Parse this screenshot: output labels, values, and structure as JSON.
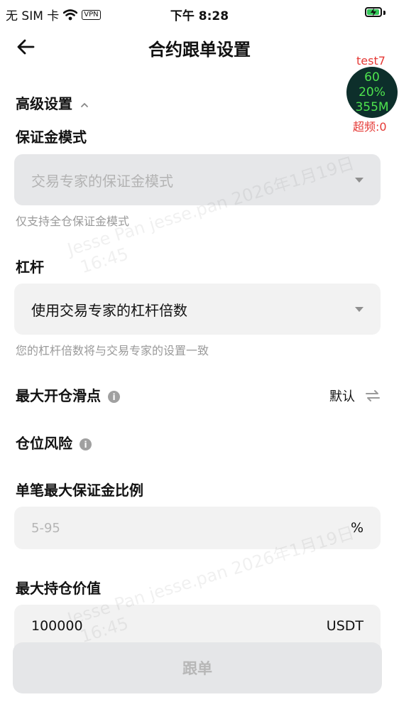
{
  "status_bar": {
    "carrier": "无 SIM 卡",
    "vpn": "VPN",
    "time": "下午 8:28"
  },
  "nav": {
    "title": "合约跟单设置"
  },
  "debug": {
    "label": "test7",
    "fps": "60",
    "cpu": "20%",
    "mem": "355M",
    "overfreq": "超频:0"
  },
  "advanced": {
    "label": "高级设置",
    "chevron": "^"
  },
  "margin_mode": {
    "label": "保证金模式",
    "value": "交易专家的保证金模式",
    "hint": "仅支持全仓保证金模式"
  },
  "leverage": {
    "label": "杠杆",
    "value": "使用交易专家的杠杆倍数",
    "hint": "您的杠杆倍数将与交易专家的设置一致"
  },
  "slippage": {
    "label": "最大开仓滑点",
    "value": "默认"
  },
  "position_risk": {
    "label": "仓位风险"
  },
  "single_margin": {
    "label": "单笔最大保证金比例",
    "placeholder": "5-95",
    "unit": "%"
  },
  "max_position": {
    "label": "最大持仓价值",
    "value": "100000",
    "unit": "USDT"
  },
  "submit": {
    "label": "跟单"
  },
  "watermark": {
    "line1": "Jesse Pan jesse.pan 2026年1月19日",
    "line2": "16:45"
  },
  "icons": {
    "back": "arrow-left-icon",
    "wifi": "wifi-icon",
    "battery": "battery-charging-icon",
    "info": "info-icon",
    "swap": "swap-icon",
    "dropdown": "caret-down-icon"
  },
  "colors": {
    "battery": "#34c759",
    "debug_text": "#4ee34e",
    "debug_red": "#e53935"
  }
}
